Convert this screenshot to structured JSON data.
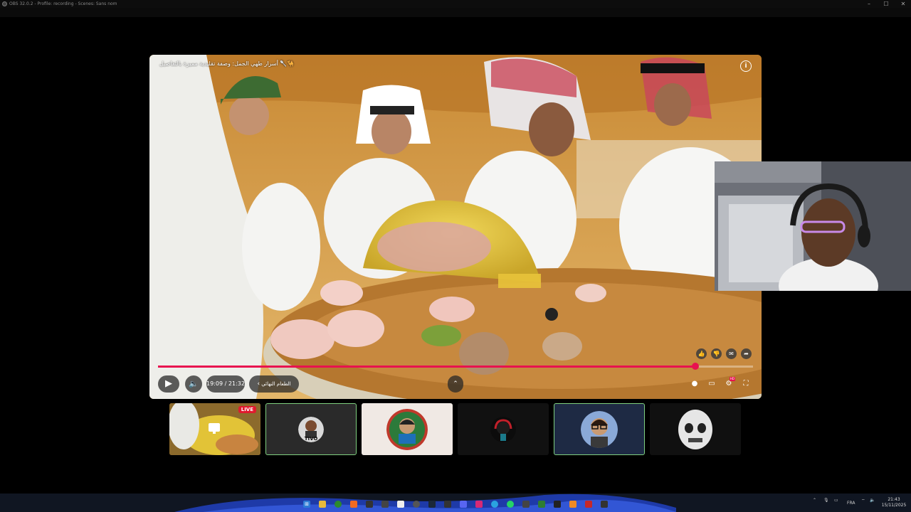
{
  "window": {
    "title": "OBS 32.0.2 - Profile: recording - Scenes: Sans nom",
    "minimize_icon": "minimize-icon",
    "maximize_icon": "maximize-icon",
    "close_icon": "close-icon"
  },
  "player": {
    "video_title": "🐪🥄 أسرار طهي الجمل: وصفة تقليدية مميزة بالتفاصيل",
    "time_display": "19:09 / 21:32",
    "chapter_label": "الطعام النهائي",
    "progress_fraction": 0.903,
    "accent_color": "#e8124f",
    "side_actions": [
      "like-icon",
      "dislike-icon",
      "comment-icon",
      "share-icon"
    ],
    "right_controls": [
      "autoplay-toggle-icon",
      "subtitles-icon",
      "settings-icon",
      "fullscreen-icon"
    ]
  },
  "participants": {
    "live_badge": "LIVE",
    "tiles": [
      {
        "name": "screen-share",
        "active": false
      },
      {
        "name": "tivo-avatar",
        "active": true
      },
      {
        "name": "man-avatar",
        "active": false
      },
      {
        "name": "red-headset-avatar",
        "active": false
      },
      {
        "name": "glasses-avatar",
        "active": true
      },
      {
        "name": "skull-avatar",
        "active": false
      }
    ]
  },
  "tivo_label": "TIVO",
  "taskbar": {
    "language": "FRA",
    "time": "21:43",
    "date": "15/11/2025"
  }
}
